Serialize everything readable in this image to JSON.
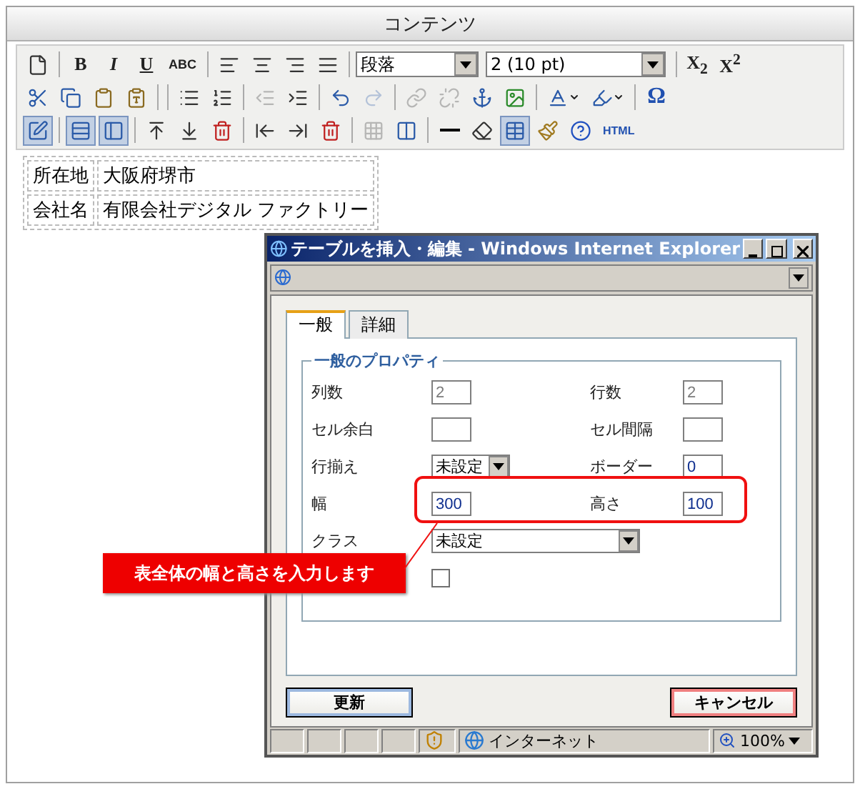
{
  "editor": {
    "title": "コンテンツ",
    "toolbar": [
      [
        {
          "kind": "button",
          "pressed": false,
          "disabled": false
        },
        {
          "kind": "sep"
        },
        {
          "kind": "button",
          "label": "B",
          "pressed": false,
          "disabled": false
        },
        {
          "kind": "button",
          "label": "I",
          "pressed": false,
          "disabled": false
        },
        {
          "kind": "button",
          "label": "U",
          "pressed": false,
          "disabled": false
        },
        {
          "kind": "button",
          "label": "ABC",
          "pressed": false,
          "disabled": false
        },
        {
          "kind": "sep"
        },
        {
          "kind": "button",
          "pressed": false,
          "disabled": false
        },
        {
          "kind": "button",
          "pressed": false,
          "disabled": false
        },
        {
          "kind": "button",
          "pressed": false,
          "disabled": false
        },
        {
          "kind": "button",
          "pressed": false,
          "disabled": false
        },
        {
          "kind": "sep"
        },
        {
          "kind": "select",
          "value": "段落"
        },
        {
          "kind": "select",
          "value": "2 (10 pt)"
        },
        {
          "kind": "sep"
        },
        {
          "kind": "button",
          "label": "X$_{2}$",
          "pressed": false,
          "disabled": false
        },
        {
          "kind": "button",
          "label": "X$^{2}$",
          "pressed": false,
          "disabled": false
        }
      ],
      [
        {
          "kind": "button",
          "pressed": false,
          "disabled": false
        },
        {
          "kind": "button",
          "pressed": false,
          "disabled": false
        },
        {
          "kind": "button",
          "pressed": false,
          "disabled": false
        },
        {
          "kind": "button",
          "pressed": false,
          "disabled": false
        },
        {
          "kind": "sep"
        },
        {
          "kind": "sep"
        },
        {
          "kind": "button",
          "pressed": false,
          "disabled": false
        },
        {
          "kind": "button",
          "pressed": false,
          "disabled": false
        },
        {
          "kind": "sep"
        },
        {
          "kind": "button",
          "pressed": false,
          "disabled": true
        },
        {
          "kind": "button",
          "pressed": false,
          "disabled": false
        },
        {
          "kind": "sep"
        },
        {
          "kind": "button",
          "pressed": false,
          "disabled": false
        },
        {
          "kind": "button",
          "pressed": false,
          "disabled": true
        },
        {
          "kind": "sep"
        },
        {
          "kind": "button",
          "pressed": false,
          "disabled": true
        },
        {
          "kind": "button",
          "pressed": false,
          "disabled": true
        },
        {
          "kind": "button",
          "pressed": false,
          "disabled": false
        },
        {
          "kind": "button",
          "pressed": false,
          "disabled": false
        },
        {
          "kind": "sep"
        },
        {
          "kind": "split",
          "pressed": false,
          "disabled": false
        },
        {
          "kind": "split",
          "pressed": false,
          "disabled": false
        },
        {
          "kind": "sep"
        },
        {
          "kind": "button",
          "label": "Ω",
          "pressed": false,
          "disabled": false
        }
      ],
      [
        {
          "kind": "button",
          "pressed": true,
          "disabled": false
        },
        {
          "kind": "sep"
        },
        {
          "kind": "button",
          "pressed": true,
          "disabled": false
        },
        {
          "kind": "button",
          "pressed": true,
          "disabled": false
        },
        {
          "kind": "sep"
        },
        {
          "kind": "button",
          "pressed": false,
          "disabled": false
        },
        {
          "kind": "button",
          "pressed": false,
          "disabled": false
        },
        {
          "kind": "button",
          "pressed": false,
          "disabled": false
        },
        {
          "kind": "sep"
        },
        {
          "kind": "button",
          "pressed": false,
          "disabled": false
        },
        {
          "kind": "button",
          "pressed": false,
          "disabled": false
        },
        {
          "kind": "button",
          "pressed": false,
          "disabled": false
        },
        {
          "kind": "sep"
        },
        {
          "kind": "button",
          "pressed": false,
          "disabled": true
        },
        {
          "kind": "button",
          "pressed": false,
          "disabled": false
        },
        {
          "kind": "sep"
        },
        {
          "kind": "button",
          "pressed": false,
          "disabled": false
        },
        {
          "kind": "button",
          "pressed": false,
          "disabled": false
        },
        {
          "kind": "button",
          "pressed": true,
          "disabled": false
        },
        {
          "kind": "button",
          "pressed": false,
          "disabled": false
        },
        {
          "kind": "button",
          "pressed": false,
          "disabled": false
        },
        {
          "kind": "button",
          "label": "HTML",
          "pressed": false,
          "disabled": false
        }
      ]
    ],
    "table": [
      [
        "所在地",
        "大阪府堺市"
      ],
      [
        "会社名",
        "有限会社デジタル ファクトリー"
      ]
    ]
  },
  "dialog": {
    "title": "テーブルを挿入・編集 - Windows Internet Explorer",
    "tabs": [
      {
        "label": "一般",
        "selected": true
      },
      {
        "label": "詳細",
        "selected": false
      }
    ],
    "legend": "一般のプロパティ",
    "rows": [
      {
        "highlighted": false,
        "fields": [
          {
            "kind": "input",
            "label": "列数",
            "value": "2",
            "disabled": true
          },
          {
            "kind": "input",
            "label": "行数",
            "value": "2",
            "disabled": true
          }
        ]
      },
      {
        "highlighted": false,
        "fields": [
          {
            "kind": "input",
            "label": "セル余白",
            "disabled": false
          },
          {
            "kind": "input",
            "label": "セル間隔",
            "disabled": false
          }
        ]
      },
      {
        "highlighted": false,
        "fields": [
          {
            "kind": "select",
            "label": "行揃え",
            "value": "未設定"
          },
          {
            "kind": "input",
            "label": "ボーダー",
            "value": "0",
            "disabled": false
          }
        ]
      },
      {
        "highlighted": true,
        "fields": [
          {
            "kind": "input",
            "label": "幅",
            "value": "300",
            "disabled": false
          },
          {
            "kind": "input",
            "label": "高さ",
            "value": "100",
            "disabled": false
          }
        ]
      },
      {
        "highlighted": false,
        "fields": [
          {
            "kind": "wideselect",
            "label": "クラス",
            "value": "未設定"
          }
        ]
      },
      {
        "highlighted": false,
        "fields": [
          {
            "kind": "checkbox",
            "checked": false
          }
        ]
      }
    ],
    "buttons": [
      {
        "kind": "submit",
        "label": "更新"
      },
      {
        "kind": "cancel",
        "label": "キャンセル"
      }
    ],
    "status": {
      "zone": "インターネット",
      "zoom": "100%"
    }
  },
  "callout": {
    "text": "表全体の幅と高さを入力します"
  }
}
